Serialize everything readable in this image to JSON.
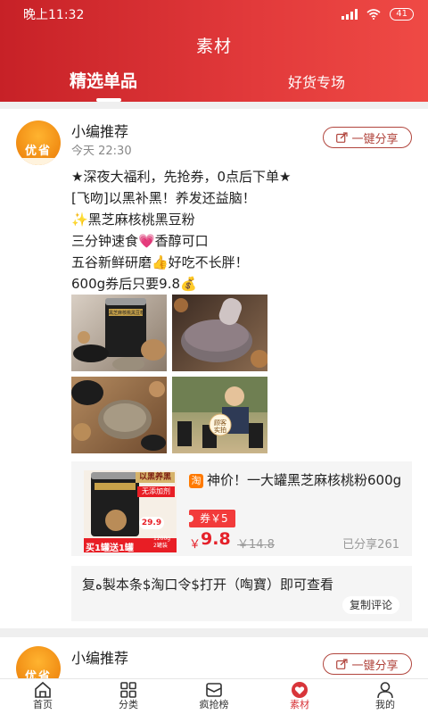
{
  "status_bar": {
    "time": "晚上11:32",
    "battery": "41"
  },
  "header": {
    "title": "素材",
    "tabs": [
      "精选单品",
      "好货专场"
    ],
    "active_tab": 0
  },
  "posts": [
    {
      "avatar_text": "优省",
      "author": "小编推荐",
      "time": "今天 22:30",
      "share_label": "一键分享",
      "lines": [
        "★深夜大福利，先抢券，0点后下单★",
        "[飞吻]以黑补黑！养发还益脑！",
        "✨黑芝麻核桃黑豆粉",
        "三分钟速食💗香醇可口",
        "五谷新鲜研磨👍好吃不长胖！",
        "600g券后只要9.8💰"
      ],
      "images": [
        {
          "icon": "jar-photo-icon",
          "label": "黑芝麻核桃黑豆粉"
        },
        {
          "icon": "bowl-photo-icon",
          "label": ""
        },
        {
          "icon": "ingredients-photo-icon",
          "label": ""
        },
        {
          "icon": "customer-photo-icon",
          "label": "顾客实拍"
        }
      ],
      "product": {
        "platform_icon": "淘",
        "title": "神价！一大罐黑芝麻核桃粉600g",
        "coupon": "券￥5",
        "price_symbol": "￥",
        "price": "9.8",
        "original_price": "￥14.8",
        "shared_count": "已分享261",
        "thumb_tags": {
          "top": "以黑养黑",
          "mid": "无添加剂",
          "promo": "买1罐送1罐",
          "size": "1200g\n2罐装",
          "price_tag": "29.9"
        }
      },
      "command": {
        "text": "复ه製本条$淘口令$打开（啕寶）即可查看",
        "copy_label": "复制评论"
      }
    },
    {
      "avatar_text": "优省",
      "author": "小编推荐",
      "share_label": "一键分享"
    }
  ],
  "bottom_nav": [
    {
      "label": "首页",
      "icon": "home-icon"
    },
    {
      "label": "分类",
      "icon": "grid-icon"
    },
    {
      "label": "疯抢榜",
      "icon": "ranking-icon"
    },
    {
      "label": "素材",
      "icon": "material-icon",
      "active": true
    },
    {
      "label": "我的",
      "icon": "user-icon"
    }
  ],
  "colors": {
    "brand": "#d8353a",
    "share_border": "#b1453d",
    "price": "#e5212a",
    "coupon": "#f23b3b"
  }
}
